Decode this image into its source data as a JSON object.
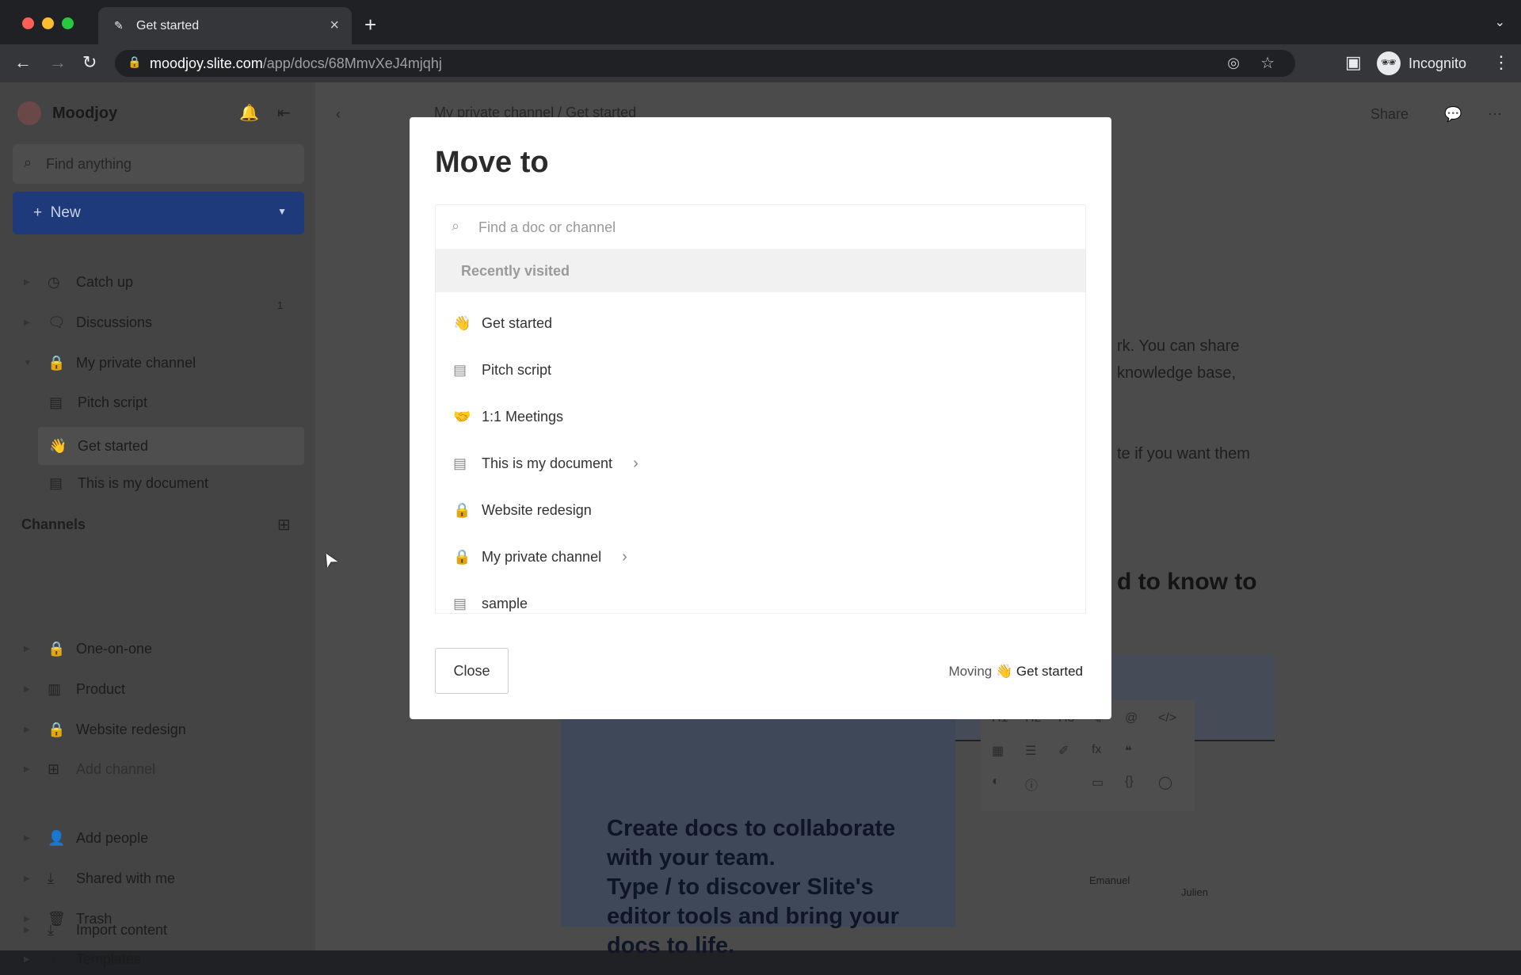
{
  "browser": {
    "tab_title": "Get started",
    "url_host": "moodjoy.slite.com",
    "url_path": "/app/docs/68MmvXeJ4mjqhj",
    "profile": "Incognito"
  },
  "sidebar": {
    "workspace": "Moodjoy",
    "search_placeholder": "Find anything",
    "new_label": "New",
    "items": [
      {
        "label": "Catch up",
        "icon": "clock-icon"
      },
      {
        "label": "Discussions",
        "icon": "discussion-icon",
        "badge": "1"
      },
      {
        "label": "My private channel",
        "icon": "lock-icon"
      },
      {
        "label": "Pitch script",
        "icon": "doc-icon"
      },
      {
        "label": "Get started",
        "icon": "👋"
      },
      {
        "label": "This is my document",
        "icon": "doc-icon"
      }
    ],
    "channels_title": "Channels",
    "channels": [
      {
        "label": "One-on-one"
      },
      {
        "label": "Product"
      },
      {
        "label": "Website redesign"
      },
      {
        "label": "Add channel"
      }
    ],
    "footer": [
      {
        "label": "Add people"
      },
      {
        "label": "Shared with me"
      },
      {
        "label": "Trash"
      },
      {
        "label": "Templates"
      },
      {
        "label": "Import content"
      }
    ]
  },
  "main": {
    "breadcrumb": [
      "My private channel",
      "Get started"
    ],
    "share": "Share",
    "para1a": "rk.  You can share",
    "para1b": "knowledge base,",
    "para2": "te if you want them",
    "heading": "d to know to",
    "card_lines": [
      "Create docs to collaborate",
      "with your team.",
      "Type  /  to discover Slite's",
      "editor tools and bring your",
      "docs to life."
    ],
    "people": [
      "Emanuel",
      "Julien"
    ]
  },
  "modal": {
    "title": "Move to",
    "search_placeholder": "Find a doc or channel",
    "section": "Recently visited",
    "items": [
      {
        "icon": "👋",
        "label": "Get started"
      },
      {
        "icon": "doc-icon",
        "label": "Pitch script"
      },
      {
        "icon": "🤝",
        "label": "1:1 Meetings"
      },
      {
        "icon": "doc-icon",
        "label": "This is my document",
        "has_children": true
      },
      {
        "icon": "lock-icon",
        "label": "Website redesign"
      },
      {
        "icon": "lock-icon",
        "label": "My private channel",
        "has_children": true
      },
      {
        "icon": "doc-icon",
        "label": "sample"
      }
    ],
    "close": "Close",
    "moving_prefix": "Moving",
    "moving_emoji": "👋",
    "moving_doc": "Get started"
  },
  "colors": {
    "accent": "#2f62d0"
  }
}
